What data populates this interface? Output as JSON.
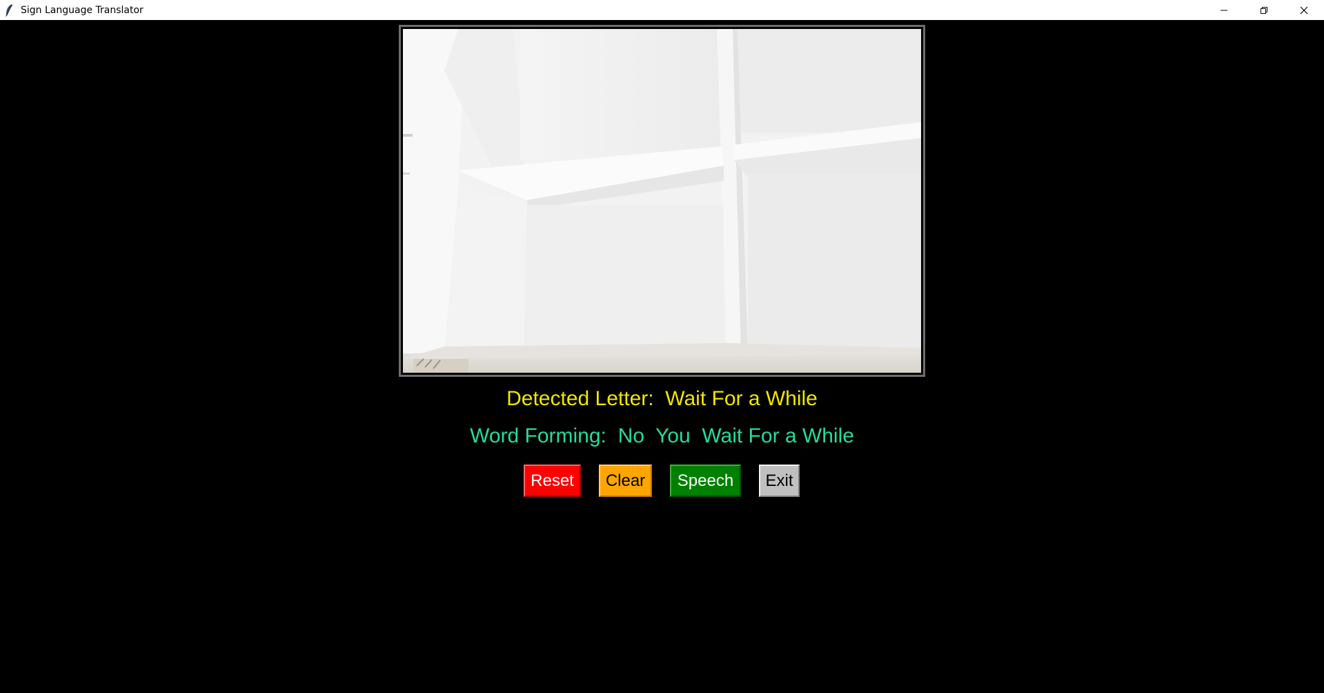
{
  "window": {
    "title": "Sign Language Translator",
    "icons": {
      "app": "feather-icon",
      "minimize": "minimize-icon",
      "restore": "restore-icon",
      "close": "close-icon"
    }
  },
  "video": {
    "description_icon": "camera-feed"
  },
  "detection": {
    "letter_label": "Detected Letter:",
    "letter_value": "Wait For a While",
    "word_label": "Word Forming:",
    "word_value": "No  You  Wait For a While"
  },
  "buttons": {
    "reset": "Reset",
    "clear": "Clear",
    "speech": "Speech",
    "exit": "Exit"
  },
  "colors": {
    "background": "#000000",
    "detected_text": "#f2e602",
    "word_text": "#25dba0",
    "reset": "#ff0000",
    "clear": "#ffa500",
    "speech": "#008000",
    "exit": "#c0c0c0"
  }
}
